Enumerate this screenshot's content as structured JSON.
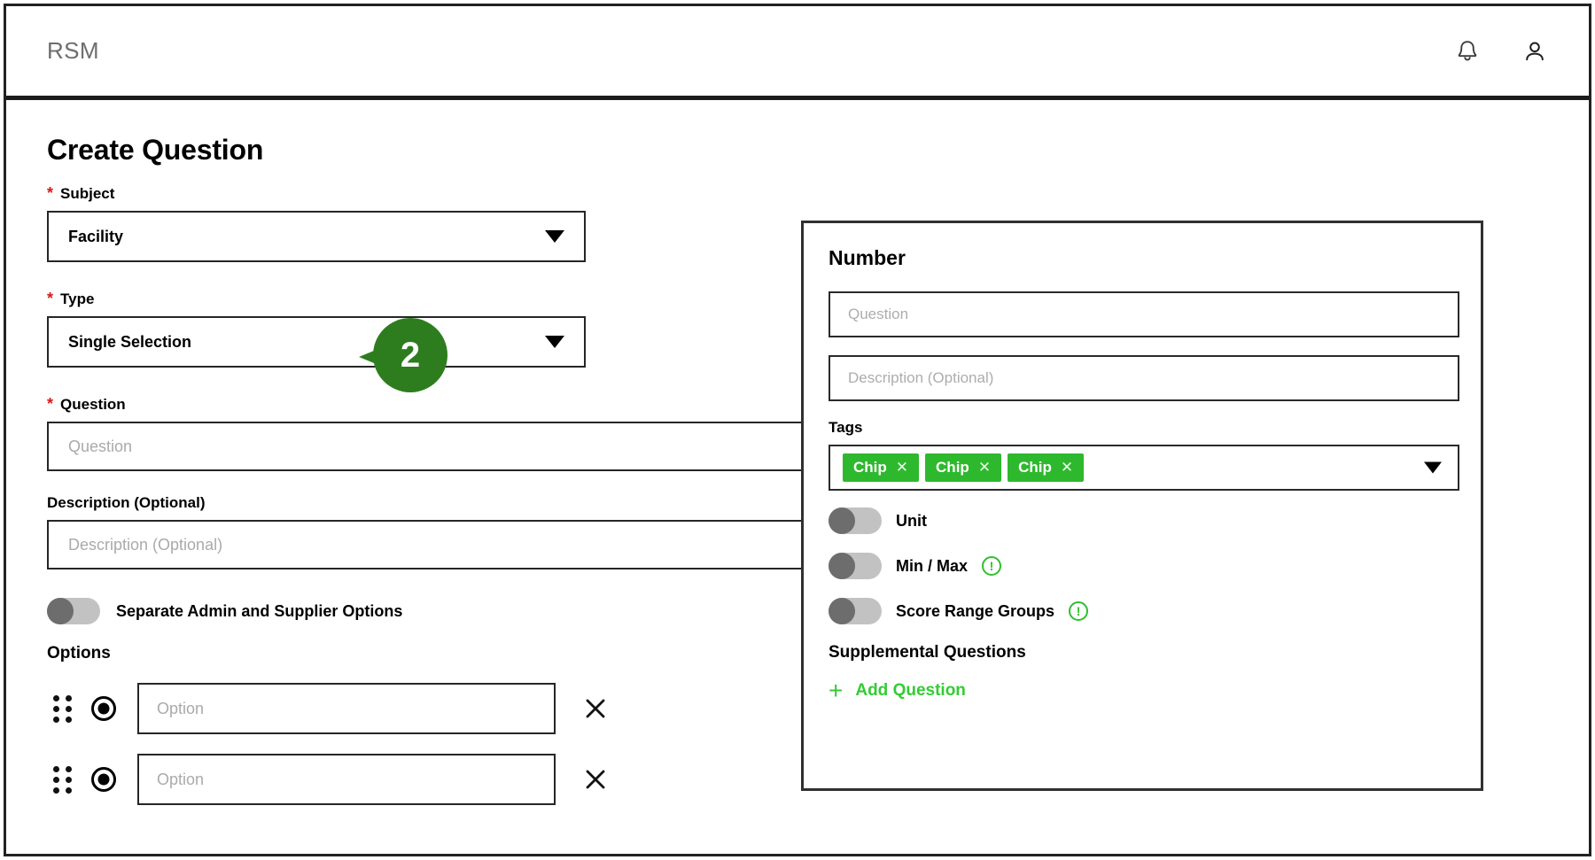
{
  "header": {
    "brand": "RSM",
    "notification_icon": "bell-icon",
    "account_icon": "person-icon"
  },
  "page": {
    "title": "Create Question"
  },
  "form": {
    "subject": {
      "label": "Subject",
      "required_marker": "*",
      "value": "Facility"
    },
    "type": {
      "label": "Type",
      "required_marker": "*",
      "value": "Single Selection"
    },
    "question": {
      "label": "Question",
      "required_marker": "*",
      "placeholder": "Question",
      "value": ""
    },
    "description": {
      "label": "Description (Optional)",
      "placeholder": "Description (Optional)",
      "value": ""
    },
    "separate_options_toggle": {
      "label": "Separate Admin and Supplier Options",
      "state": "off"
    },
    "options_heading": "Options",
    "options": [
      {
        "placeholder": "Option",
        "value": "",
        "selected": true
      },
      {
        "placeholder": "Option",
        "value": "",
        "selected": true
      }
    ]
  },
  "number_panel": {
    "title": "Number",
    "question": {
      "placeholder": "Question",
      "value": ""
    },
    "description": {
      "placeholder": "Description (Optional)",
      "value": ""
    },
    "tags": {
      "label": "Tags",
      "chips": [
        "Chip",
        "Chip",
        "Chip"
      ],
      "chip_remove_glyph": "✕"
    },
    "toggles": [
      {
        "label": "Unit",
        "state": "off",
        "info": false
      },
      {
        "label": "Min / Max",
        "state": "off",
        "info": true
      },
      {
        "label": "Score Range Groups",
        "state": "off",
        "info": true
      }
    ],
    "info_glyph": "!",
    "supplemental_heading": "Supplemental Questions",
    "add_question": {
      "plus": "+",
      "label": "Add Question"
    }
  },
  "callout": {
    "number": "2"
  },
  "colors": {
    "callout_green": "#2d7d1e",
    "chip_green": "#2eb82e",
    "link_green": "#33cc33",
    "info_green": "#2fbf2f",
    "required_red": "#d81919",
    "border_dark": "#262626",
    "brand_gray": "#6e6e6e",
    "placeholder_gray": "#aaaaaa",
    "toggle_track": "#c2c2c2",
    "toggle_knob": "#6d6d6d"
  }
}
